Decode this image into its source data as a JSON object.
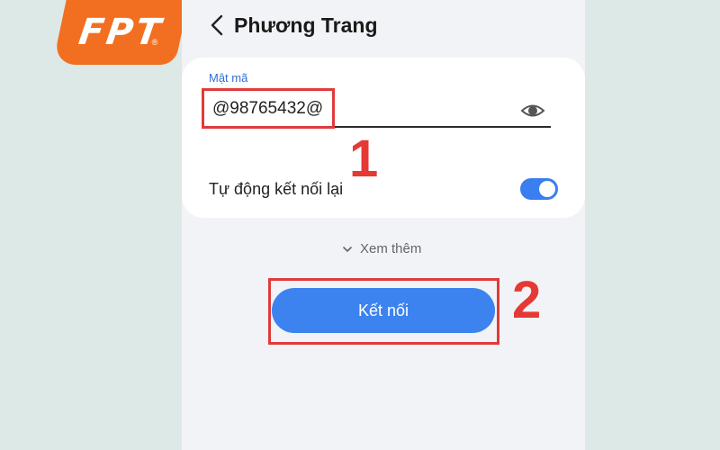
{
  "logo": {
    "text": "FPT",
    "registered": "®"
  },
  "header": {
    "title": "Phương Trang",
    "back_icon": "chevron-left-icon"
  },
  "password": {
    "label": "Mật mã",
    "value": "@98765432@",
    "visibility_icon": "eye-icon"
  },
  "auto_reconnect": {
    "label": "Tự động kết nối lại",
    "enabled": true
  },
  "more": {
    "label": "Xem thêm",
    "icon": "chevron-down-icon"
  },
  "connect_button": {
    "label": "Kết nối"
  },
  "annotations": {
    "step1": "1",
    "step2": "2",
    "color": "#e03a3a"
  },
  "colors": {
    "accent": "#3d83ef",
    "brand": "#f26f21",
    "background": "#dce9e6"
  }
}
